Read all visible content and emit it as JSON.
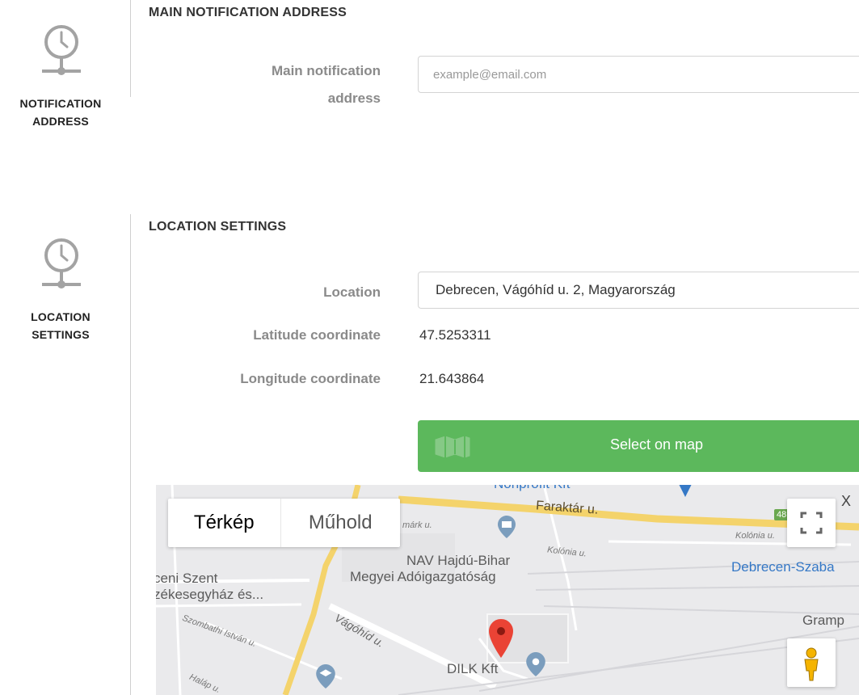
{
  "notification": {
    "section_title": "MAIN NOTIFICATION ADDRESS",
    "side_label_line1": "NOTIFICATION",
    "side_label_line2": "ADDRESS",
    "field_label_line1": "Main notification",
    "field_label_line2": "address",
    "email_placeholder": "example@email.com",
    "email_value": ""
  },
  "location": {
    "section_title": "LOCATION SETTINGS",
    "side_label_line1": "LOCATION",
    "side_label_line2": "SETTINGS",
    "location_label": "Location",
    "location_value": "Debrecen, Vágóhíd u. 2, Magyarország",
    "latitude_label": "Latitude coordinate",
    "latitude_value": "47.5253311",
    "longitude_label": "Longitude coordinate",
    "longitude_value": "21.643864",
    "select_on_map_label": "Select on map"
  },
  "map": {
    "map_type_map": "Térkép",
    "map_type_satellite": "Műhold",
    "close_label": "X",
    "places": {
      "nav": "NAV Hajdú-Bihar",
      "nav2": "Megyei Adóigazgatóság",
      "church1": "ceni Szent",
      "church2": "zékesegyház és...",
      "station": "Debrecen-Szaba",
      "gramp": "Gramp",
      "dilk": "DILK Kft",
      "nonprofit": "Nonprofit Kft",
      "route": "48"
    },
    "streets": {
      "faraktar": "Faraktár u.",
      "kolonia1": "Kolónia u.",
      "kolonia2": "Kolónia u.",
      "vagohid": "Vágóhíd u.",
      "szombathi": "Szombathi István u.",
      "halap": "Haláp u.",
      "mark": "márk u."
    }
  },
  "colors": {
    "accent_green": "#5cb85c",
    "marker_red": "#ea4335",
    "road_yellow": "#fdd835"
  }
}
